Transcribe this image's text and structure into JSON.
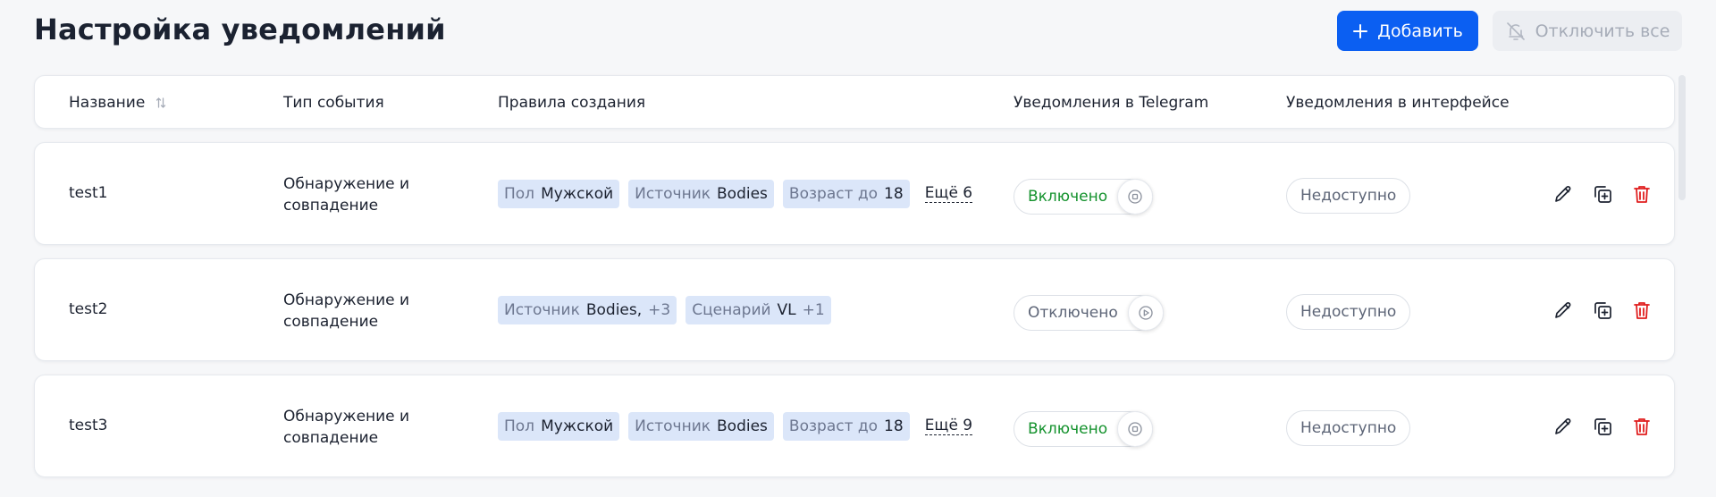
{
  "page": {
    "title": "Настройка уведомлений",
    "add_button": "Добавить",
    "disable_all_button": "Отключить все"
  },
  "columns": {
    "name": "Название",
    "event_type": "Тип события",
    "rules": "Правила создания",
    "telegram": "Уведомления в Telegram",
    "interface": "Уведомления в интерфейсе"
  },
  "rows": [
    {
      "name": "test1",
      "event_type": "Обнаружение и совпадение",
      "rules": [
        {
          "key": "Пол",
          "value": "Мужской",
          "extra": ""
        },
        {
          "key": "Источник",
          "value": "Bodies",
          "extra": ""
        },
        {
          "key": "Возраст до",
          "value": "18",
          "extra": ""
        }
      ],
      "more": "Ещё 6",
      "telegram": "Включено",
      "telegram_enabled": true,
      "interface": "Недоступно"
    },
    {
      "name": "test2",
      "event_type": "Обнаружение и совпадение",
      "rules": [
        {
          "key": "Источник",
          "value": "Bodies,",
          "extra": "+3"
        },
        {
          "key": "Сценарий",
          "value": "VL",
          "extra": "+1"
        }
      ],
      "more": "",
      "telegram": "Отключено",
      "telegram_enabled": false,
      "interface": "Недоступно"
    },
    {
      "name": "test3",
      "event_type": "Обнаружение и совпадение",
      "rules": [
        {
          "key": "Пол",
          "value": "Мужской",
          "extra": ""
        },
        {
          "key": "Источник",
          "value": "Bodies",
          "extra": ""
        },
        {
          "key": "Возраст до",
          "value": "18",
          "extra": ""
        }
      ],
      "more": "Ещё 9",
      "telegram": "Включено",
      "telegram_enabled": true,
      "interface": "Недоступно"
    }
  ],
  "colors": {
    "accent": "#0b5ff2",
    "enabled": "#14922d",
    "delete": "#e01f1f",
    "tag_bg": "#dbe6f9"
  },
  "icons": {
    "add": "plus-icon",
    "disable_all": "bell-off-icon",
    "sort": "sort-icon",
    "toggle_on": "stop-circle-icon",
    "toggle_off": "play-circle-icon",
    "edit": "pencil-icon",
    "copy": "copy-plus-icon",
    "delete": "trash-icon"
  }
}
